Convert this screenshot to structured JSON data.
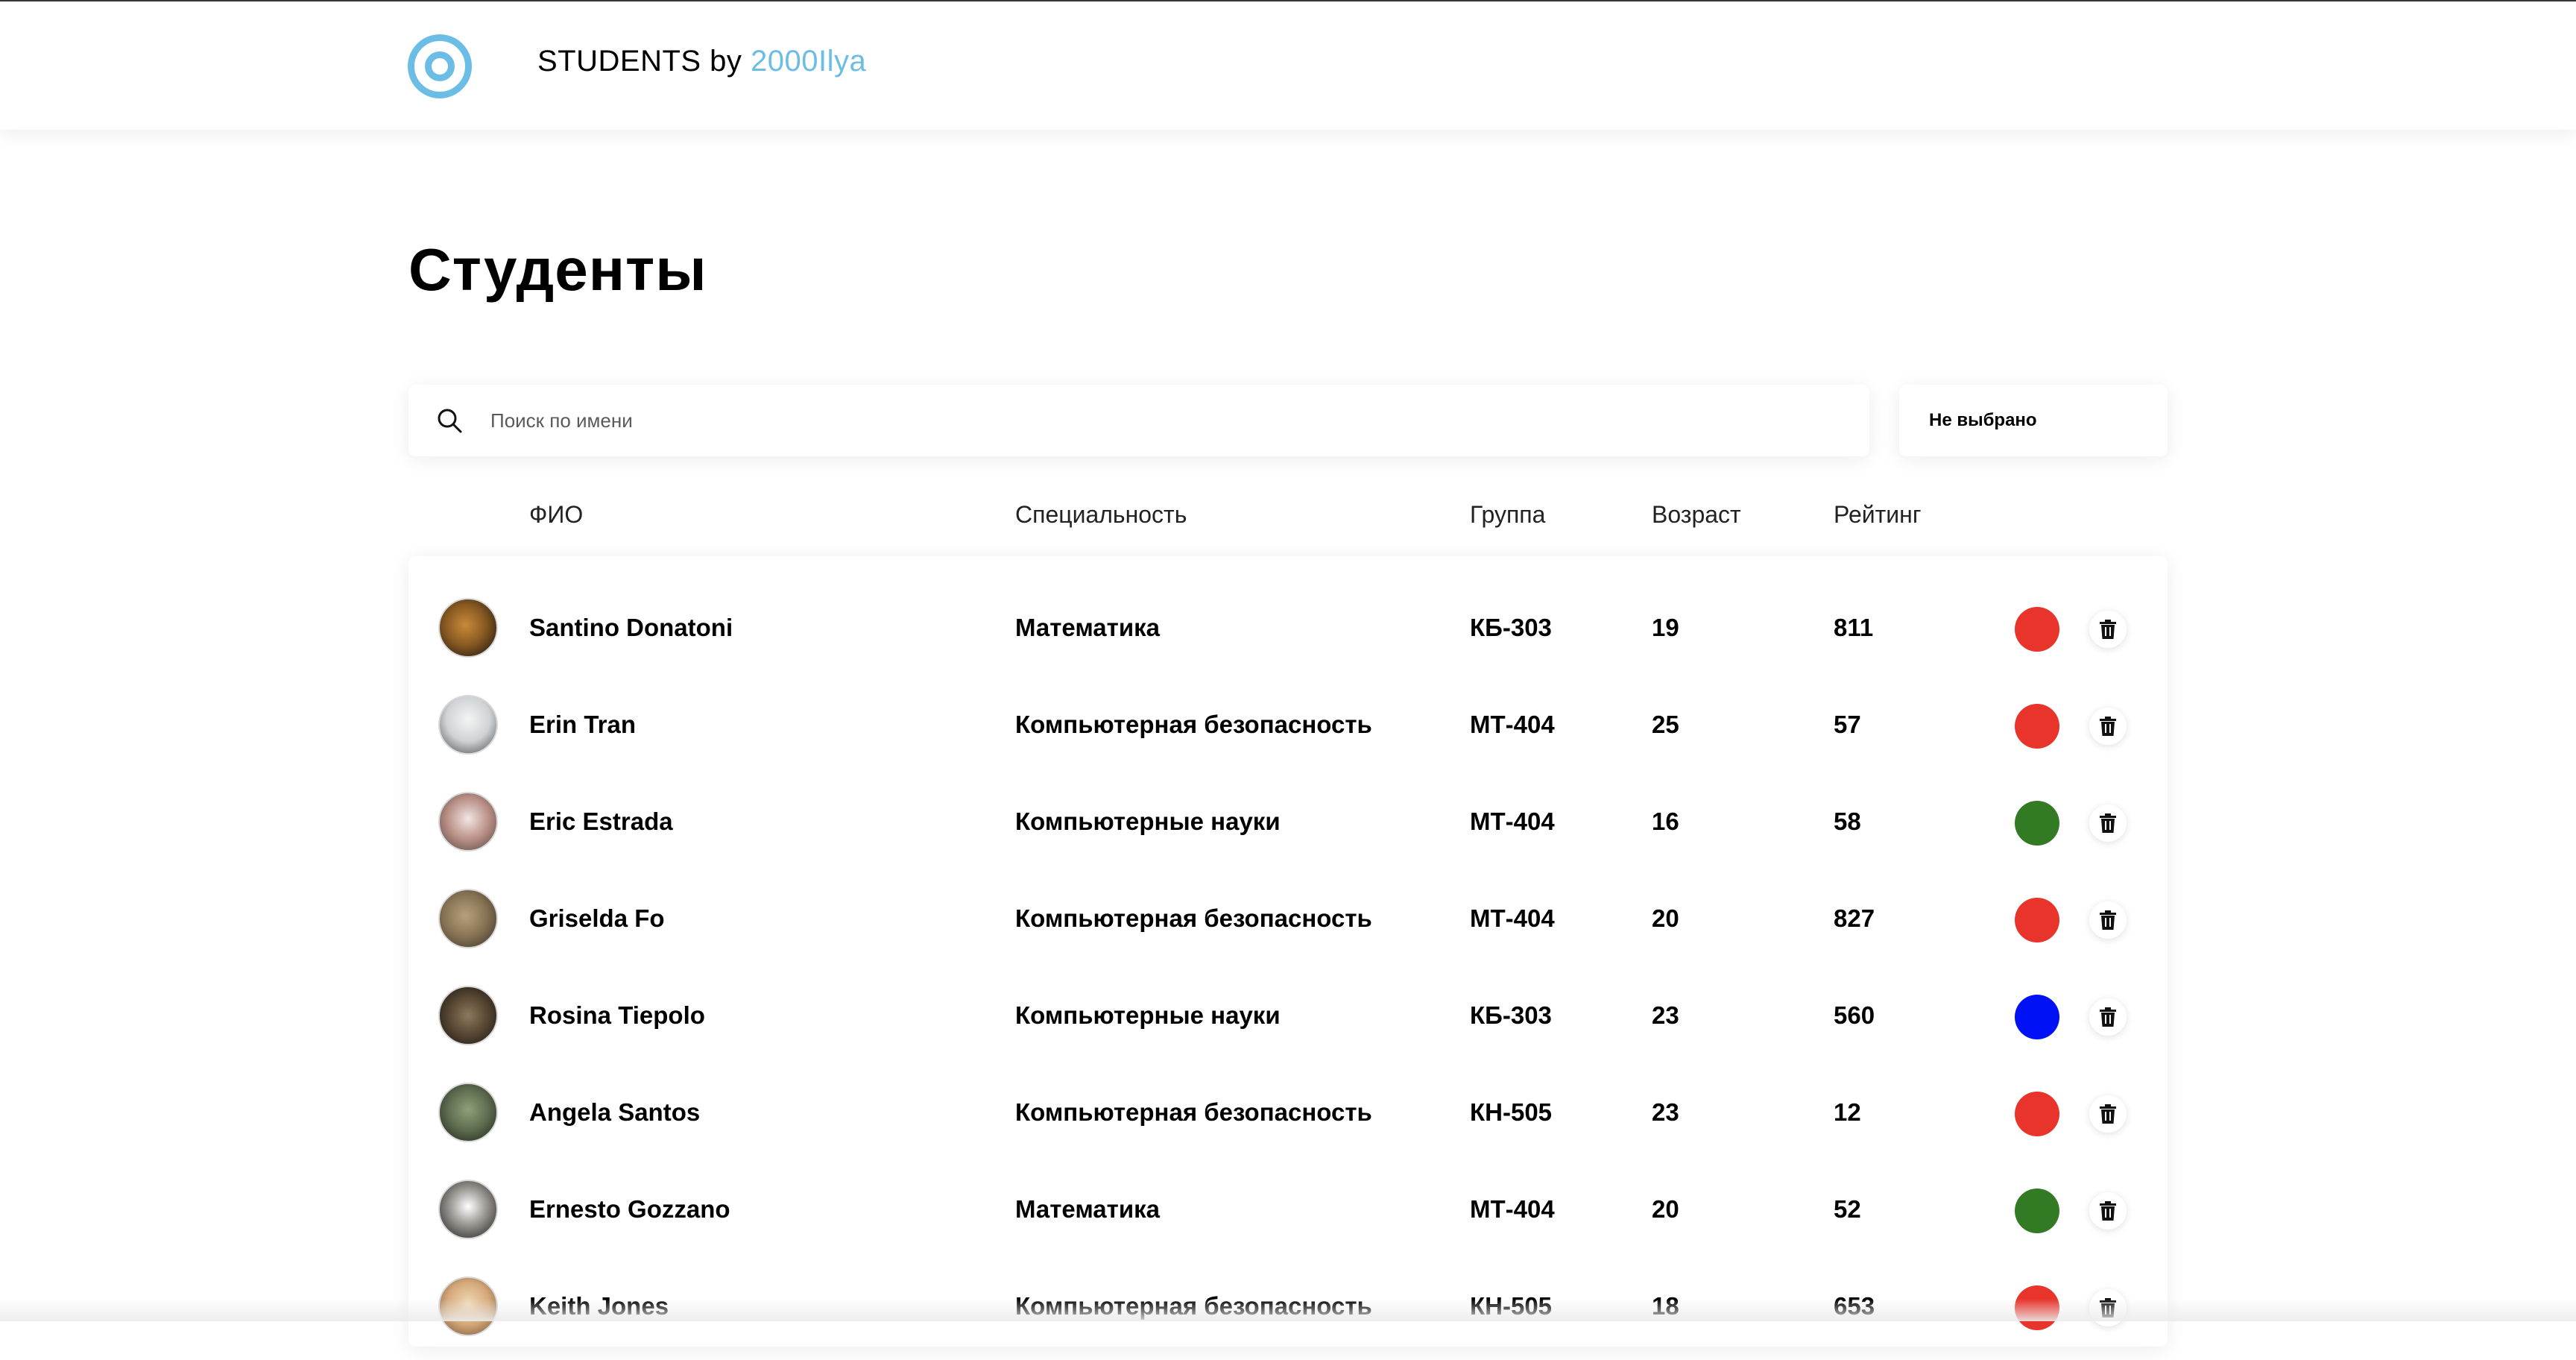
{
  "header": {
    "brand_prefix": "STUDENTS by ",
    "brand_accent": "2000Ilya",
    "logo_icon": "ring-logo-icon",
    "accent_color": "#6cbde6"
  },
  "page": {
    "title": "Студенты"
  },
  "search": {
    "placeholder": "Поиск по имени",
    "value": "",
    "icon": "search-icon"
  },
  "filter": {
    "selected": "Не выбрано"
  },
  "table": {
    "columns": {
      "name": "ФИО",
      "specialty": "Специальность",
      "group": "Группа",
      "age": "Возраст",
      "rating": "Рейтинг"
    },
    "rows": [
      {
        "name": "Santino Donatoni",
        "specialty": "Математика",
        "group": "КБ-303",
        "age": "19",
        "rating": "811",
        "color": "#e8342a"
      },
      {
        "name": "Erin Tran",
        "specialty": "Компьютерная безопасность",
        "group": "МТ-404",
        "age": "25",
        "rating": "57",
        "color": "#e8342a"
      },
      {
        "name": "Eric Estrada",
        "specialty": "Компьютерные науки",
        "group": "МТ-404",
        "age": "16",
        "rating": "58",
        "color": "#327a24"
      },
      {
        "name": "Griselda Fo",
        "specialty": "Компьютерная безопасность",
        "group": "МТ-404",
        "age": "20",
        "rating": "827",
        "color": "#e8342a"
      },
      {
        "name": "Rosina Tiepolo",
        "specialty": "Компьютерные науки",
        "group": "КБ-303",
        "age": "23",
        "rating": "560",
        "color": "#0011f5"
      },
      {
        "name": "Angela Santos",
        "specialty": "Компьютерная безопасность",
        "group": "КН-505",
        "age": "23",
        "rating": "12",
        "color": "#e8342a"
      },
      {
        "name": "Ernesto Gozzano",
        "specialty": "Математика",
        "group": "МТ-404",
        "age": "20",
        "rating": "52",
        "color": "#327a24"
      },
      {
        "name": "Keith Jones",
        "specialty": "Компьютерная безопасность",
        "group": "КН-505",
        "age": "18",
        "rating": "653",
        "color": "#e8342a"
      }
    ]
  }
}
